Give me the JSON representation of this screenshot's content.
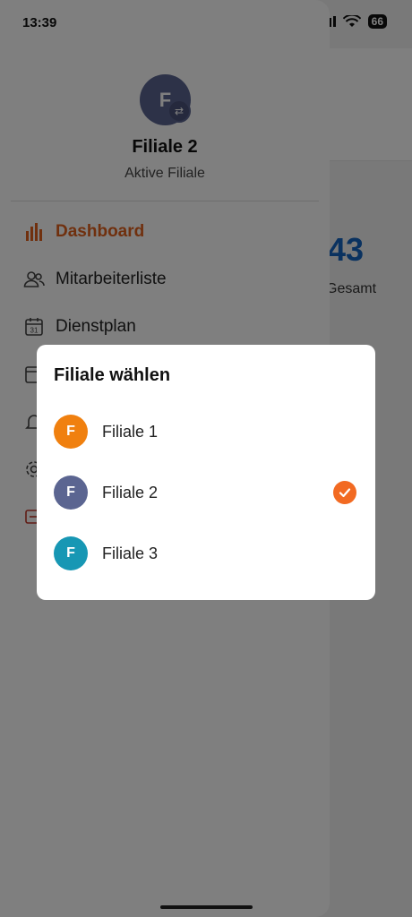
{
  "status_bar": {
    "time": "13:39",
    "battery": "66"
  },
  "background": {
    "stat_value": "43",
    "stat_label": "Gesamt"
  },
  "drawer": {
    "avatar_letter": "F",
    "title": "Filiale 2",
    "subtitle": "Aktive Filiale",
    "menu": [
      {
        "label": "Dashboard",
        "icon": "bar-chart-icon"
      },
      {
        "label": "Mitarbeiterliste",
        "icon": "users-icon"
      },
      {
        "label": "Dienstplan",
        "icon": "calendar-icon"
      }
    ]
  },
  "dialog": {
    "title": "Filiale wählen",
    "options": [
      {
        "letter": "F",
        "label": "Filiale 1",
        "color": "#f0800f",
        "selected": false
      },
      {
        "letter": "F",
        "label": "Filiale 2",
        "color": "#5b6591",
        "selected": true
      },
      {
        "letter": "F",
        "label": "Filiale 3",
        "color": "#1797b4",
        "selected": false
      }
    ]
  },
  "colors": {
    "accent": "#f26a22",
    "menu_active": "#e0601c",
    "stat_blue": "#1565c0"
  }
}
